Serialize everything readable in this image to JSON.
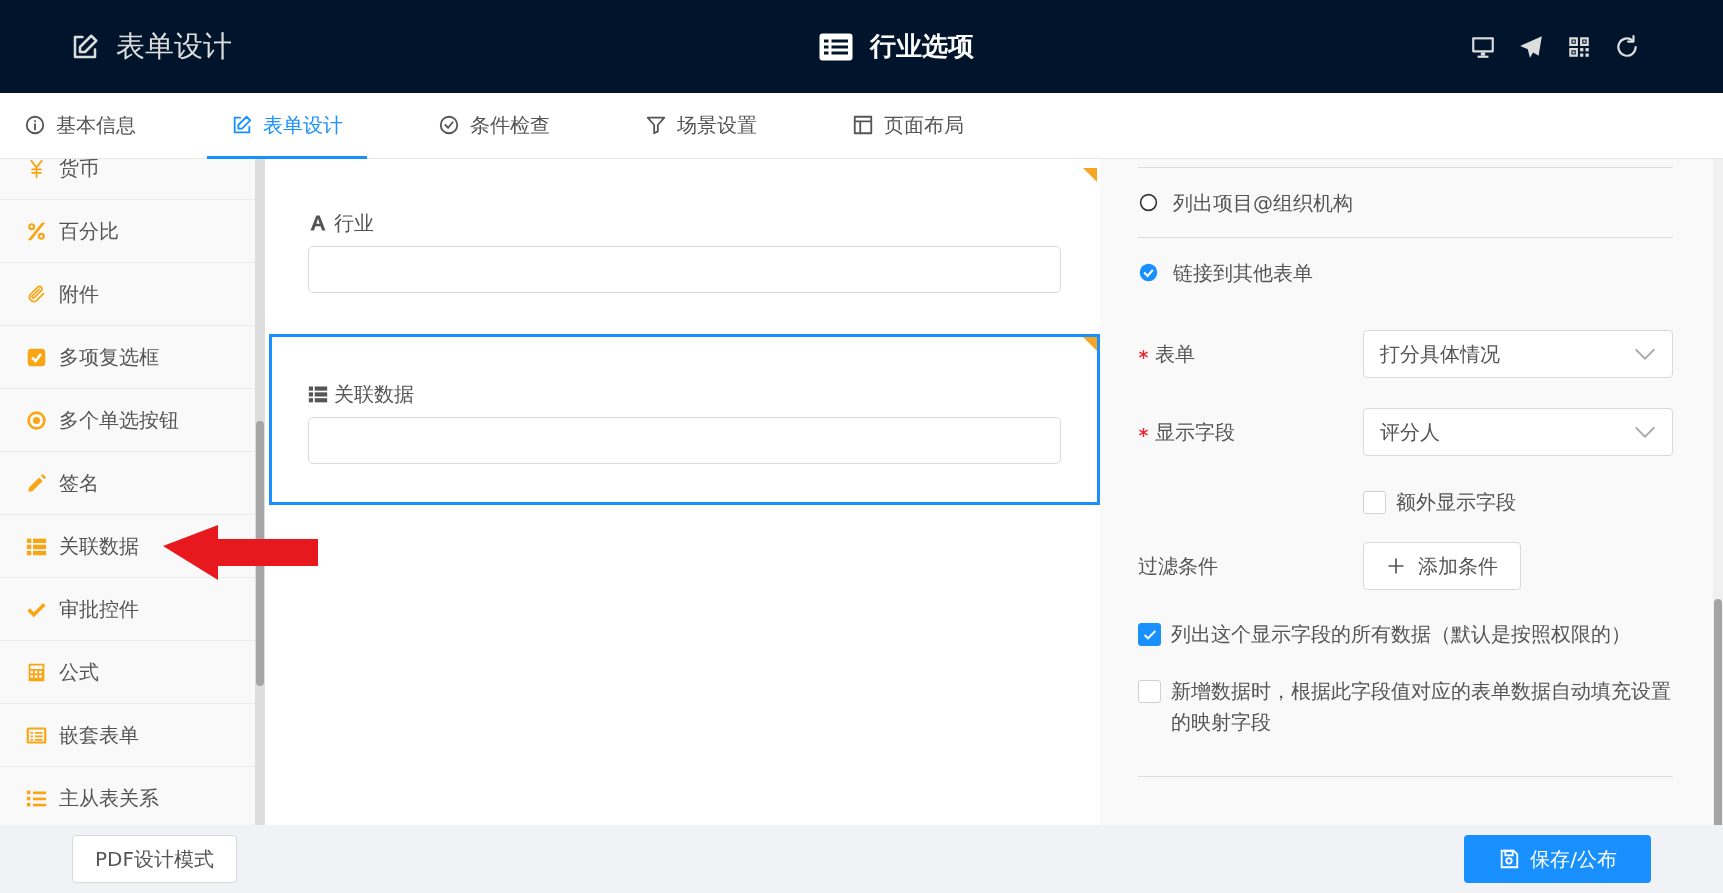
{
  "header": {
    "left_title": "表单设计",
    "center_title": "行业选项",
    "actions": [
      {
        "kind": "monitor"
      },
      {
        "kind": "send"
      },
      {
        "kind": "qrcode"
      },
      {
        "kind": "refresh"
      }
    ]
  },
  "tabs": [
    {
      "label": "基本信息",
      "kind": "info",
      "selected": false
    },
    {
      "label": "表单设计",
      "kind": "edit",
      "selected": true
    },
    {
      "label": "条件检查",
      "kind": "check",
      "selected": false
    },
    {
      "label": "场景设置",
      "kind": "filter",
      "selected": false
    },
    {
      "label": "页面布局",
      "kind": "layout",
      "selected": false
    }
  ],
  "sidebar": {
    "items": [
      {
        "label": "货币",
        "kind": "currency"
      },
      {
        "label": "百分比",
        "kind": "percent"
      },
      {
        "label": "附件",
        "kind": "attachment"
      },
      {
        "label": "多项复选框",
        "kind": "checkbox"
      },
      {
        "label": "多个单选按钮",
        "kind": "radio"
      },
      {
        "label": "签名",
        "kind": "signature"
      },
      {
        "label": "关联数据",
        "kind": "link"
      },
      {
        "label": "审批控件",
        "kind": "approval"
      },
      {
        "label": "公式",
        "kind": "formula"
      },
      {
        "label": "嵌套表单",
        "kind": "subform"
      },
      {
        "label": "主从表关系",
        "kind": "relation"
      }
    ]
  },
  "canvas": {
    "fields": [
      {
        "label": "行业",
        "kind": "text",
        "selected": false
      },
      {
        "label": "关联数据",
        "kind": "link",
        "selected": true
      }
    ]
  },
  "properties": {
    "options": [
      {
        "label": "列出项目@组织机构",
        "selected": false
      },
      {
        "label": "链接到其他表单",
        "selected": true
      }
    ],
    "selects": [
      {
        "label": "表单",
        "required": true,
        "value": "打分具体情况"
      },
      {
        "label": "显示字段",
        "required": true,
        "value": "评分人"
      }
    ],
    "extra_field": {
      "label": "额外显示字段",
      "checked": false
    },
    "filter": {
      "label": "过滤条件",
      "button": "添加条件"
    },
    "checks": [
      {
        "label": "列出这个显示字段的所有数据（默认是按照权限的）",
        "checked": true
      },
      {
        "label": "新增数据时，根据此字段值对应的表单数据自动填充设置的映射字段",
        "checked": false
      }
    ]
  },
  "footer": {
    "left_button": "PDF设计模式",
    "right_button": "保存/公布"
  }
}
